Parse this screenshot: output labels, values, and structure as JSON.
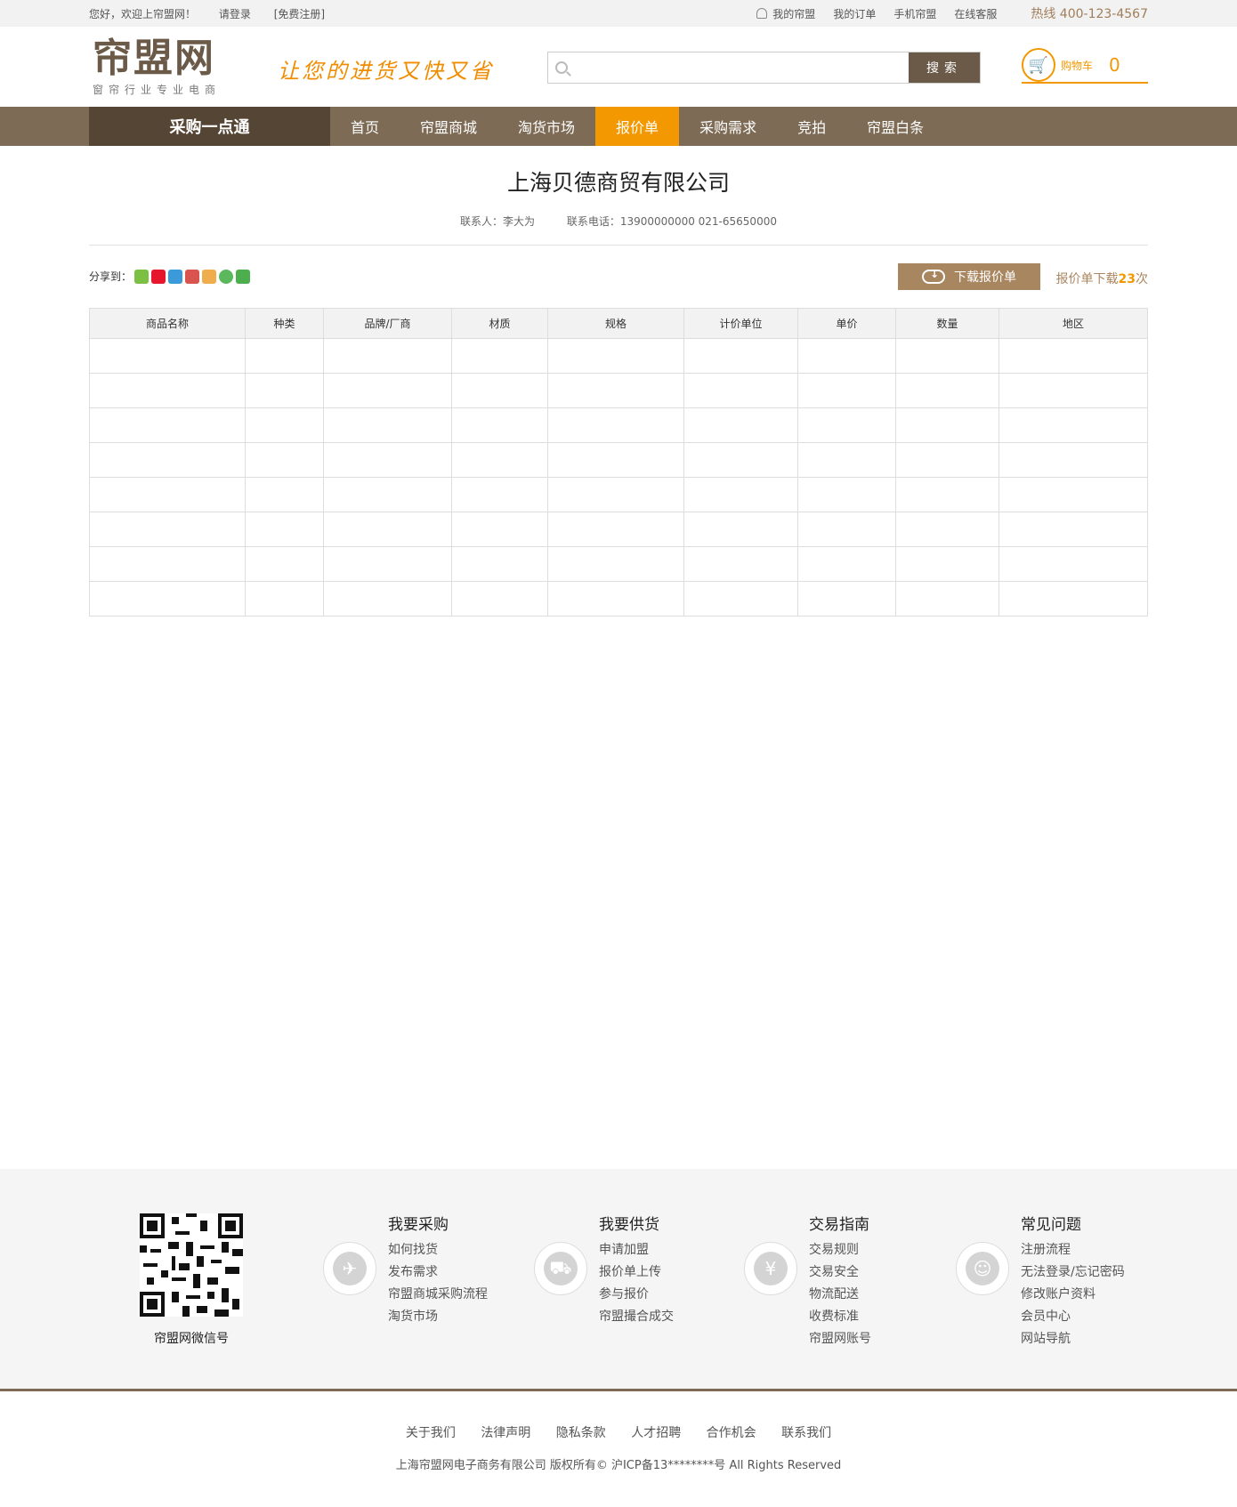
{
  "topbar": {
    "welcome": "您好，欢迎上帘盟网！",
    "login": "请登录",
    "register": "[免费注册]",
    "my_account": "我的帘盟",
    "my_orders": "我的订单",
    "mobile": "手机帘盟",
    "service": "在线客服",
    "hotline": "热线 400-123-4567"
  },
  "header": {
    "logo": "帘盟网",
    "logo_sub": "窗帘行业专业电商",
    "slogan": "让您的进货又快又省",
    "search_placeholder": "",
    "search_button": "搜索",
    "cart_label": "购物车",
    "cart_count": "0"
  },
  "nav": {
    "title": "采购一点通",
    "items": [
      "首页",
      "帘盟商城",
      "淘货市场",
      "报价单",
      "采购需求",
      "竞拍",
      "帘盟白条"
    ],
    "active_index": 3
  },
  "main": {
    "company": "上海贝德商贸有限公司",
    "contact_person": "联系人：李大为",
    "contact_phone": "联系电话：13900000000  021-65650000",
    "share_label": "分享到：",
    "download_button": "下载报价单",
    "download_count_prefix": "报价单下载",
    "download_count": "23",
    "download_count_suffix": "次"
  },
  "table": {
    "headers": [
      "商品名称",
      "种类",
      "品牌/厂商",
      "材质",
      "规格",
      "计价单位",
      "单价",
      "数量",
      "地区"
    ]
  },
  "footer": {
    "qr_label": "帘盟网微信号",
    "columns": [
      {
        "title": "我要采购",
        "icon": "compass-icon",
        "glyph": "✈",
        "items": [
          "如何找货",
          "发布需求",
          "帘盟商城采购流程",
          "淘货市场"
        ]
      },
      {
        "title": "我要供货",
        "icon": "truck-icon",
        "glyph": "⛟",
        "items": [
          "申请加盟",
          "报价单上传",
          "参与报价",
          "帘盟撮合成交"
        ]
      },
      {
        "title": "交易指南",
        "icon": "yen-icon",
        "glyph": "¥",
        "items": [
          "交易规则",
          "交易安全",
          "物流配送",
          "收费标准",
          "帘盟网账号"
        ]
      },
      {
        "title": "常见问题",
        "icon": "user-icon",
        "glyph": "☺",
        "items": [
          "注册流程",
          "无法登录/忘记密码",
          "修改账户资料",
          "会员中心",
          "网站导航"
        ]
      }
    ],
    "links": [
      "关于我们",
      "法律声明",
      "隐私条款",
      "人才招聘",
      "合作机会",
      "联系我们"
    ],
    "copyright": "上海帘盟网电子商务有限公司 版权所有©  沪ICP备13********号 All Rights Reserved"
  },
  "colors": {
    "brand": "#7e6b55",
    "accent": "#f39800",
    "dark": "#554535"
  }
}
